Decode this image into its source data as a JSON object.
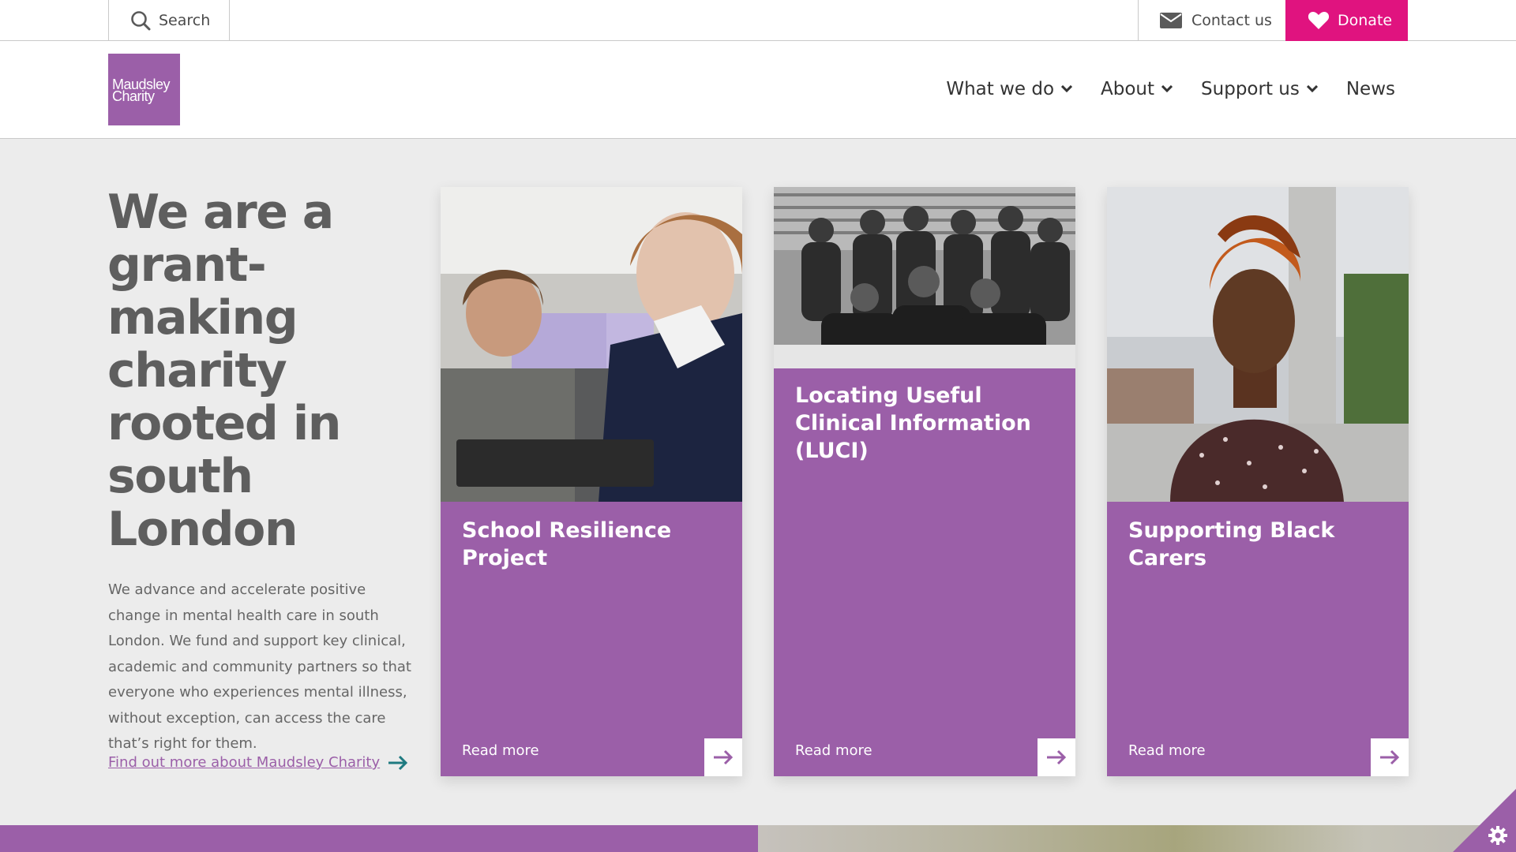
{
  "topbar": {
    "search_label": "Search",
    "contact_label": "Contact us",
    "donate_label": "Donate"
  },
  "header": {
    "logo_line1": "Maudsley",
    "logo_line2": "Charity",
    "nav": [
      {
        "label": "What we do",
        "has_dropdown": true
      },
      {
        "label": "About",
        "has_dropdown": true
      },
      {
        "label": "Support us",
        "has_dropdown": true
      },
      {
        "label": "News",
        "has_dropdown": false
      }
    ]
  },
  "hero": {
    "title": "We are a grant-making charity rooted in south London",
    "text": "We advance and accelerate positive change in mental health care in south London. We fund and support key clinical, academic and community partners so that everyone who experiences mental illness, without exception, can access the care that’s right for them.",
    "link_label": "Find out more about Maudsley Charity"
  },
  "cards": [
    {
      "title": "School Resilience Project",
      "read_more": "Read more"
    },
    {
      "title": "Locating Useful Clinical Information (LUCI)",
      "read_more": "Read more"
    },
    {
      "title": "Supporting Black Carers",
      "read_more": "Read more"
    }
  ],
  "colors": {
    "brand_purple": "#9b5fa8",
    "donate_pink": "#e0137f",
    "link_arrow_teal": "#1f7a80"
  },
  "icons": [
    "search-icon",
    "envelope-icon",
    "heart-icon",
    "chevron-down-icon",
    "arrow-right-icon",
    "gear-icon"
  ]
}
